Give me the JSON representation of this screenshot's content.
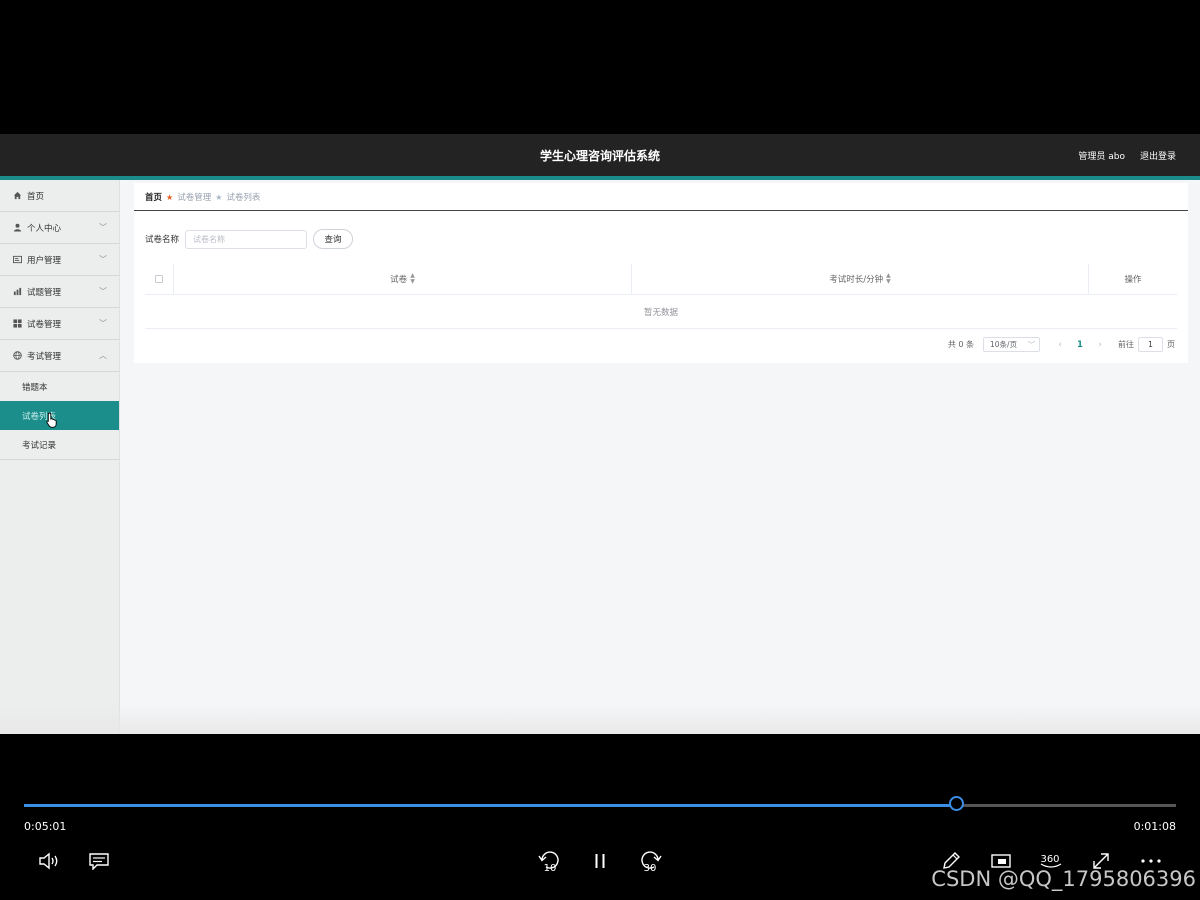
{
  "app": {
    "title": "学生心理咨询评估系统",
    "user_label": "管理员 abo",
    "logout_label": "退出登录"
  },
  "sidebar": {
    "items": [
      {
        "label": "首页",
        "icon": "home-icon"
      },
      {
        "label": "个人中心",
        "icon": "user-icon",
        "chevron": "down"
      },
      {
        "label": "用户管理",
        "icon": "user-card-icon",
        "chevron": "down"
      },
      {
        "label": "试题管理",
        "icon": "chart-icon",
        "chevron": "down"
      },
      {
        "label": "试卷管理",
        "icon": "grid-icon",
        "chevron": "down"
      },
      {
        "label": "考试管理",
        "icon": "globe-icon",
        "chevron": "up"
      }
    ],
    "subitems": [
      {
        "label": "错题本"
      },
      {
        "label": "试卷列表",
        "active": true
      },
      {
        "label": "考试记录"
      }
    ]
  },
  "breadcrumb": {
    "home": "首页",
    "middle": "试卷管理",
    "current": "试卷列表"
  },
  "search": {
    "label": "试卷名称",
    "placeholder": "试卷名称",
    "button": "查询"
  },
  "table": {
    "columns": [
      "试卷",
      "考试时长/分钟",
      "操作"
    ],
    "empty_text": "暂无数据"
  },
  "pagination": {
    "total": "共 0 条",
    "page_size": "10条/页",
    "current_page": "1",
    "goto_label": "前往",
    "goto_value": "1",
    "page_suffix": "页"
  },
  "player": {
    "elapsed": "0:05:01",
    "remaining": "0:01:08",
    "progress": 0.81,
    "accent_color": "#3a8ee6",
    "controls": [
      "volume-icon",
      "subtitles-icon",
      "rewind-10-icon",
      "pause-icon",
      "forward-30-icon",
      "pen-icon",
      "miniplayer-icon",
      "360-icon",
      "fullscreen-icon",
      "more-icon"
    ],
    "rewind_label": "10",
    "forward_label": "30",
    "vr_label": "360"
  },
  "watermark": "CSDN @QQ_1795806396",
  "colors": {
    "teal": "#1b8e8b",
    "header_bg": "#232323"
  }
}
